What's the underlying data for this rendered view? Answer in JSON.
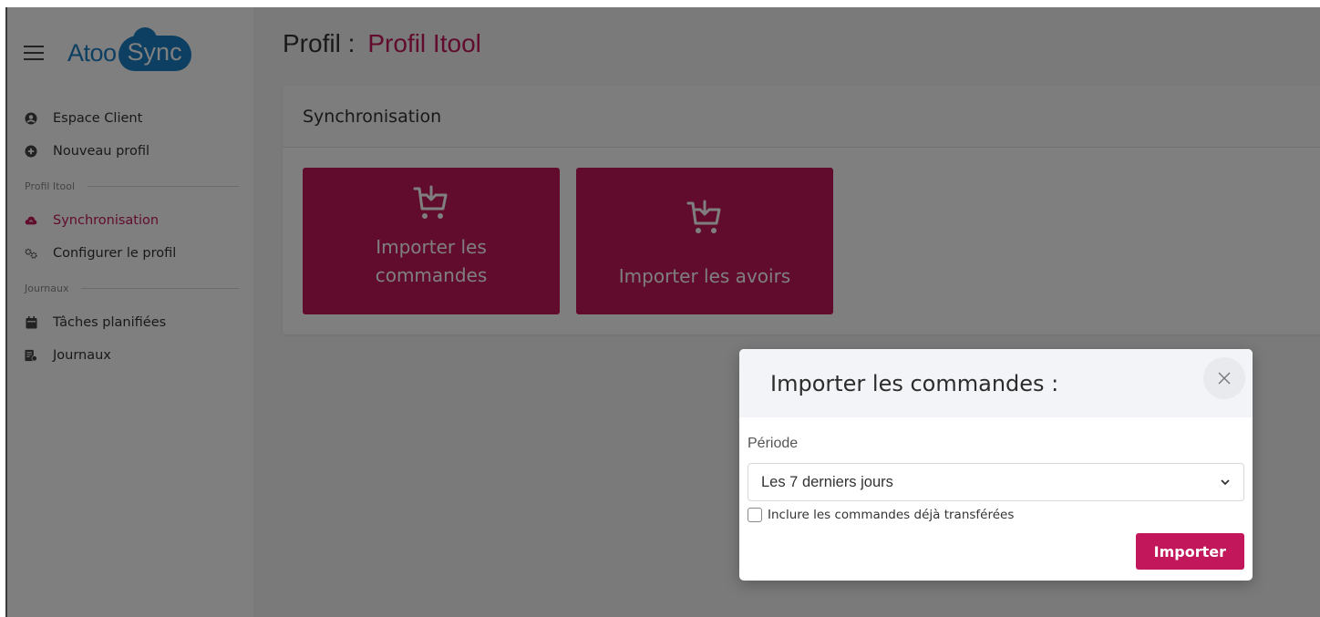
{
  "brand": {
    "name_part1": "Atoo",
    "name_part2": "Sync"
  },
  "sidebar": {
    "items": [
      {
        "label": "Espace Client",
        "icon": "user-circle-icon"
      },
      {
        "label": "Nouveau profil",
        "icon": "plus-circle-icon"
      }
    ],
    "section_profile": "Profil Itool",
    "profile_items": [
      {
        "label": "Synchronisation",
        "icon": "cloud-sync-icon",
        "active": true
      },
      {
        "label": "Configurer le profil",
        "icon": "gears-icon"
      }
    ],
    "section_logs": "Journaux",
    "log_items": [
      {
        "label": "Tâches planifiées",
        "icon": "calendar-icon"
      },
      {
        "label": "Journaux",
        "icon": "log-file-icon"
      }
    ]
  },
  "page": {
    "title_prefix": "Profil :",
    "title_name": "Profil Itool"
  },
  "card": {
    "header": "Synchronisation",
    "tiles": [
      {
        "label": "Importer les commandes",
        "icon": "cart-download-icon"
      },
      {
        "label": "Importer les avoirs",
        "icon": "cart-download-icon"
      }
    ]
  },
  "modal": {
    "title": "Importer les commandes :",
    "field_label": "Période",
    "select_value": "Les 7 derniers jours",
    "checkbox_label": "Inclure les commandes déjà transférées",
    "checkbox_checked": false,
    "submit_label": "Importer"
  },
  "colors": {
    "accent": "#c2185b",
    "brand_blue": "#1a7fc4",
    "overlay": "rgba(0,0,0,0.5)"
  }
}
